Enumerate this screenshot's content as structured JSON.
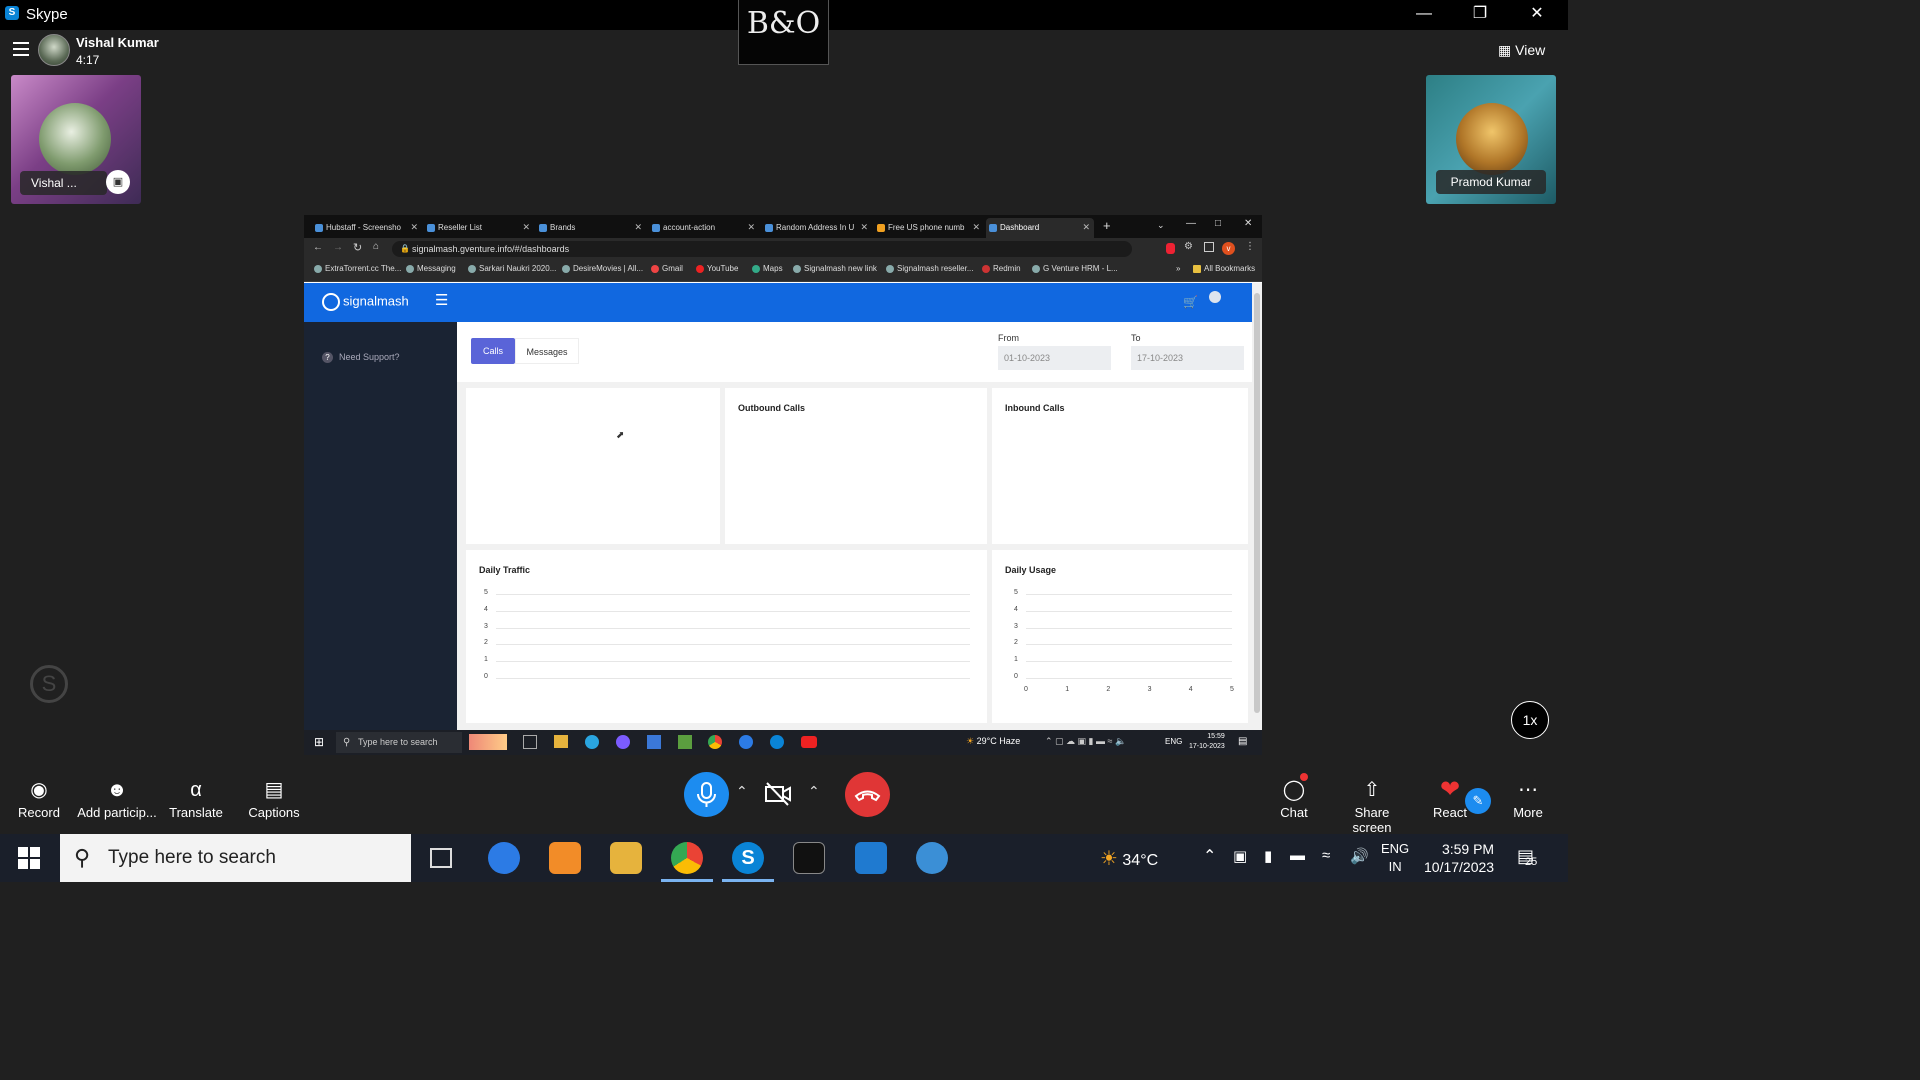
{
  "window": {
    "app_title": "Skype"
  },
  "badge": {
    "text": "B&O"
  },
  "call": {
    "caller_name": "Vishal Kumar",
    "timer": "4:17",
    "view_label": "View",
    "self_tile_name": "Vishal ...",
    "other_tile_name": "Pramod Kumar",
    "speed_label": "1x"
  },
  "browser": {
    "tabs": [
      {
        "label": "Hubstaff - Screensho"
      },
      {
        "label": "Reseller List"
      },
      {
        "label": "Brands"
      },
      {
        "label": "account-action"
      },
      {
        "label": "Random Address In U"
      },
      {
        "label": "Free US phone numb"
      },
      {
        "label": "Dashboard"
      }
    ],
    "url": "signalmash.gventure.info/#/dashboards",
    "bookmarks": [
      "ExtraTorrent.cc The...",
      "Messaging",
      "Sarkari Naukri 2020...",
      "DesireMovies | All...",
      "Gmail",
      "YouTube",
      "Maps",
      "Signalmash new link",
      "Signalmash reseller...",
      "Redmin",
      "G Venture HRM - L...",
      "All Bookmarks"
    ]
  },
  "dashboard": {
    "logo_text": "signalmash",
    "need_support": "Need Support?",
    "tab_calls": "Calls",
    "tab_messages": "Messages",
    "from_label": "From",
    "from_value": "01-10-2023",
    "to_label": "To",
    "to_value": "17-10-2023",
    "outbound_title": "Outbound Calls",
    "inbound_title": "Inbound Calls",
    "daily_traffic_title": "Daily Traffic",
    "daily_usage_title": "Daily Usage"
  },
  "chart_data": [
    {
      "type": "line",
      "title": "Daily Traffic",
      "ylim": [
        0,
        5
      ],
      "yticks": [
        "5",
        "4",
        "3",
        "2",
        "1",
        "0"
      ],
      "series": []
    },
    {
      "type": "line",
      "title": "Daily Usage",
      "ylim": [
        0,
        5
      ],
      "xlim": [
        0,
        5
      ],
      "yticks": [
        "5",
        "4",
        "3",
        "2",
        "1",
        "0"
      ],
      "xticks": [
        "0",
        "1",
        "2",
        "3",
        "4",
        "5"
      ],
      "series": []
    }
  ],
  "inner_taskbar": {
    "search_placeholder": "Type here to search",
    "weather": "29°C Haze",
    "lang": "ENG",
    "time": "15:59",
    "date": "17-10-2023"
  },
  "controls": {
    "record": "Record",
    "add_participants": "Add particip...",
    "translate": "Translate",
    "captions": "Captions",
    "chat": "Chat",
    "share_screen": "Share screen",
    "react": "React",
    "more": "More"
  },
  "taskbar": {
    "search_placeholder": "Type here to search",
    "temperature": "34°C",
    "lang_top": "ENG",
    "lang_bottom": "IN",
    "time": "3:59 PM",
    "date": "10/17/2023",
    "notification_count": "25"
  }
}
